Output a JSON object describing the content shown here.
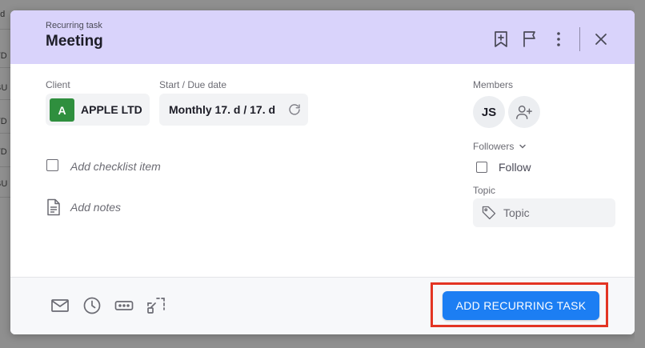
{
  "background": {
    "peek_texts": [
      "od",
      "TD",
      "BU",
      "TD",
      "TD",
      "BU"
    ]
  },
  "modal": {
    "kicker": "Recurring task",
    "title": "Meeting",
    "header_icons": [
      "bookmark-plus-icon",
      "flag-icon",
      "more-vertical-icon",
      "close-icon"
    ]
  },
  "client": {
    "label": "Client",
    "avatar_letter": "A",
    "name": "APPLE LTD"
  },
  "dates": {
    "label": "Start / Due date",
    "value": "Monthly 17. d / 17. d"
  },
  "checklist": {
    "placeholder": "Add checklist item"
  },
  "notes": {
    "placeholder": "Add notes"
  },
  "members": {
    "label": "Members",
    "initials": "JS"
  },
  "followers": {
    "label": "Followers",
    "follow_label": "Follow"
  },
  "topic": {
    "label": "Topic",
    "placeholder": "Topic"
  },
  "footer": {
    "icons": [
      "mail-icon",
      "clock-icon",
      "password-field-icon",
      "scan-icon"
    ],
    "primary_label": "ADD RECURRING TASK"
  },
  "colors": {
    "header_bg": "#d9d3fb",
    "primary": "#1c7ef3",
    "highlight": "#e33423",
    "client_avatar": "#2f8f3e"
  }
}
